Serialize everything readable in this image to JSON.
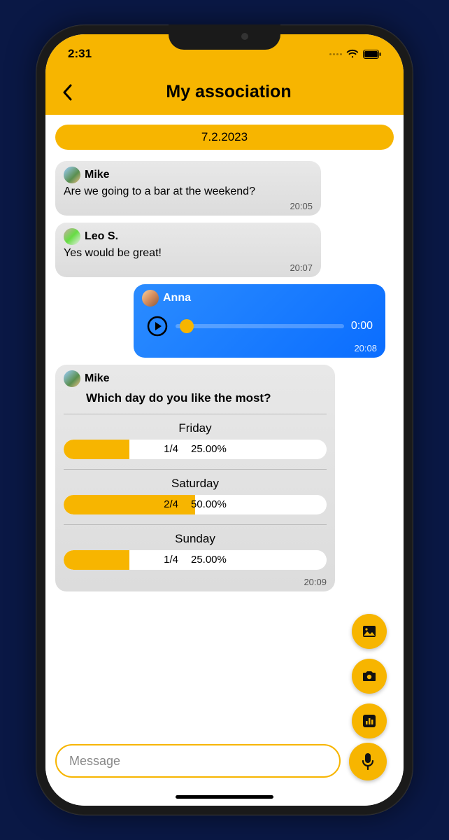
{
  "status": {
    "time": "2:31"
  },
  "header": {
    "title": "My association"
  },
  "date_chip": "7.2.2023",
  "messages": [
    {
      "sender": "Mike",
      "text": "Are we going to a bar at the weekend?",
      "time": "20:05"
    },
    {
      "sender": "Leo S.",
      "text": "Yes would be great!",
      "time": "20:07"
    },
    {
      "sender": "Anna",
      "audio_time": "0:00",
      "time": "20:08"
    },
    {
      "sender": "Mike",
      "poll_question": "Which day do you like the most?",
      "time": "20:09",
      "options": [
        {
          "label": "Friday",
          "count": "1/4",
          "percent": "25.00%",
          "fill": 25
        },
        {
          "label": "Saturday",
          "count": "2/4",
          "percent": "50.00%",
          "fill": 50
        },
        {
          "label": "Sunday",
          "count": "1/4",
          "percent": "25.00%",
          "fill": 25
        }
      ]
    }
  ],
  "input": {
    "placeholder": "Message"
  }
}
